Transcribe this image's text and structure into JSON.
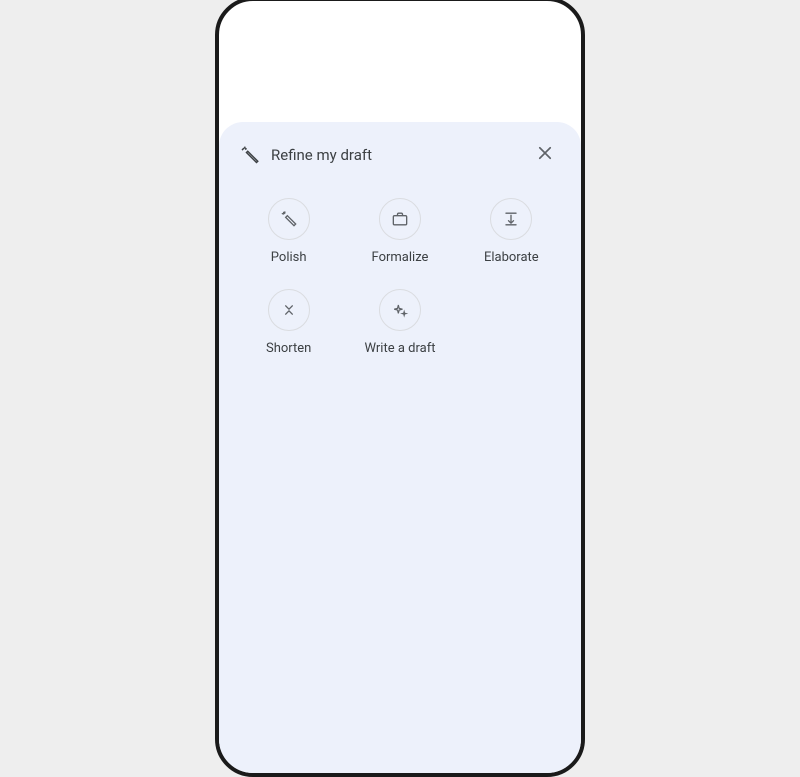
{
  "sheet": {
    "title": "Refine my draft",
    "options": [
      {
        "id": "polish",
        "label": "Polish"
      },
      {
        "id": "formalize",
        "label": "Formalize"
      },
      {
        "id": "elaborate",
        "label": "Elaborate"
      },
      {
        "id": "shorten",
        "label": "Shorten"
      },
      {
        "id": "write-draft",
        "label": "Write a draft"
      }
    ]
  }
}
